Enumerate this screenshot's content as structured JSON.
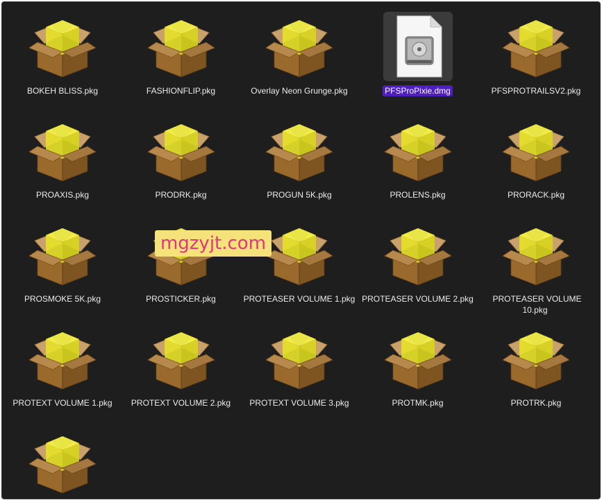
{
  "watermark": "mgzyjt.com",
  "files": [
    {
      "name": "BOKEH BLISS.pkg",
      "icon": "package-icon",
      "selected": false
    },
    {
      "name": "FASHIONFLIP.pkg",
      "icon": "package-icon",
      "selected": false
    },
    {
      "name": "Overlay Neon Grunge.pkg",
      "icon": "package-icon",
      "selected": false
    },
    {
      "name": "PFSProPixie.dmg",
      "icon": "disk-image-icon",
      "selected": true
    },
    {
      "name": "PFSPROTRAILSV2.pkg",
      "icon": "package-icon",
      "selected": false
    },
    {
      "name": "PROAXIS.pkg",
      "icon": "package-icon",
      "selected": false
    },
    {
      "name": "PRODRK.pkg",
      "icon": "package-icon",
      "selected": false
    },
    {
      "name": "PROGUN 5K.pkg",
      "icon": "package-icon",
      "selected": false
    },
    {
      "name": "PROLENS.pkg",
      "icon": "package-icon",
      "selected": false
    },
    {
      "name": "PRORACK.pkg",
      "icon": "package-icon",
      "selected": false
    },
    {
      "name": "PROSMOKE 5K.pkg",
      "icon": "package-icon",
      "selected": false
    },
    {
      "name": "PROSTICKER.pkg",
      "icon": "package-icon",
      "selected": false
    },
    {
      "name": "PROTEASER VOLUME 1.pkg",
      "icon": "package-icon",
      "selected": false
    },
    {
      "name": "PROTEASER VOLUME 2.pkg",
      "icon": "package-icon",
      "selected": false
    },
    {
      "name": "PROTEASER VOLUME 10.pkg",
      "icon": "package-icon",
      "selected": false
    },
    {
      "name": "PROTEXT VOLUME 1.pkg",
      "icon": "package-icon",
      "selected": false
    },
    {
      "name": "PROTEXT VOLUME 2.pkg",
      "icon": "package-icon",
      "selected": false
    },
    {
      "name": "PROTEXT VOLUME 3.pkg",
      "icon": "package-icon",
      "selected": false
    },
    {
      "name": "PROTMK.pkg",
      "icon": "package-icon",
      "selected": false
    },
    {
      "name": "PROTRK.pkg",
      "icon": "package-icon",
      "selected": false
    },
    {
      "name": "",
      "icon": "package-icon",
      "selected": false
    }
  ]
}
